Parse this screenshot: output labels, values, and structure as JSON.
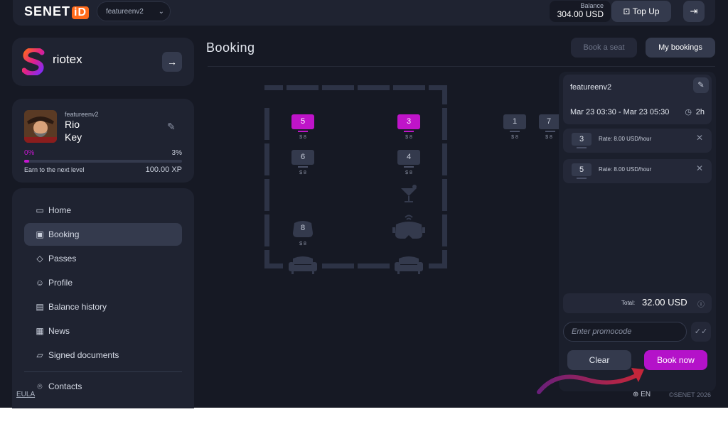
{
  "header": {
    "logo_text": "SENET",
    "logo_id": "iD",
    "club_select": "featureenv2",
    "balance_label": "Balance",
    "balance_value": "304.00 USD",
    "topup_label": "Top Up",
    "icons": {
      "topup": "wallet-icon",
      "logout": "logout-icon"
    }
  },
  "tenant": {
    "name": "riotex",
    "arrow_icon": "arrow-right-icon"
  },
  "profile": {
    "username": "featureenv2",
    "first_name": "Rio",
    "last_name": "Key",
    "level_start": "0%",
    "level_end": "3%",
    "level_progress": 0.03,
    "earn_label": "Earn to the next level",
    "xp_value": "100.00",
    "xp_unit": "XP"
  },
  "nav": {
    "items": [
      {
        "label": "Home",
        "icon": "monitor-icon"
      },
      {
        "label": "Booking",
        "icon": "booking-icon",
        "active": true
      },
      {
        "label": "Passes",
        "icon": "ticket-icon"
      },
      {
        "label": "Profile",
        "icon": "user-icon"
      },
      {
        "label": "Balance history",
        "icon": "wallet-icon"
      },
      {
        "label": "News",
        "icon": "news-icon"
      },
      {
        "label": "Signed documents",
        "icon": "folder-icon"
      },
      {
        "label": "Contacts",
        "icon": "location-icon"
      }
    ],
    "eula": "EULA"
  },
  "main": {
    "title": "Booking",
    "tab_book": "Book a seat",
    "tab_mine": "My bookings"
  },
  "map": {
    "seats": [
      {
        "num": "5",
        "price": "$ 8",
        "selected": true
      },
      {
        "num": "3",
        "price": "$ 8",
        "selected": true
      },
      {
        "num": "6",
        "price": "$ 8",
        "selected": false
      },
      {
        "num": "4",
        "price": "$ 8",
        "selected": false
      },
      {
        "num": "8",
        "price": "$ 8",
        "selected": false,
        "type": "vr"
      },
      {
        "num": "1",
        "price": "$ 8",
        "selected": false
      },
      {
        "num": "7",
        "price": "$ 8",
        "selected": false
      }
    ],
    "decor_icons": [
      "cocktail-icon",
      "vr-headset-icon",
      "sofa-icon"
    ]
  },
  "booking": {
    "host": "featureenv2",
    "time_range": "Mar 23 03:30 - Mar 23 05:30",
    "duration": "2h",
    "items": [
      {
        "seat": "3",
        "rate": "Rate: 8.00 USD/hour"
      },
      {
        "seat": "5",
        "rate": "Rate: 8.00 USD/hour"
      }
    ],
    "total_label": "Total:",
    "total_value": "32.00 USD",
    "promo_placeholder": "Enter promocode",
    "clear_label": "Clear",
    "book_label": "Book now"
  },
  "footer": {
    "lang": "EN",
    "copyright": "©SENET 2026"
  },
  "colors": {
    "accent": "#bf14c9",
    "background": "#161924",
    "card": "#1f2331"
  }
}
